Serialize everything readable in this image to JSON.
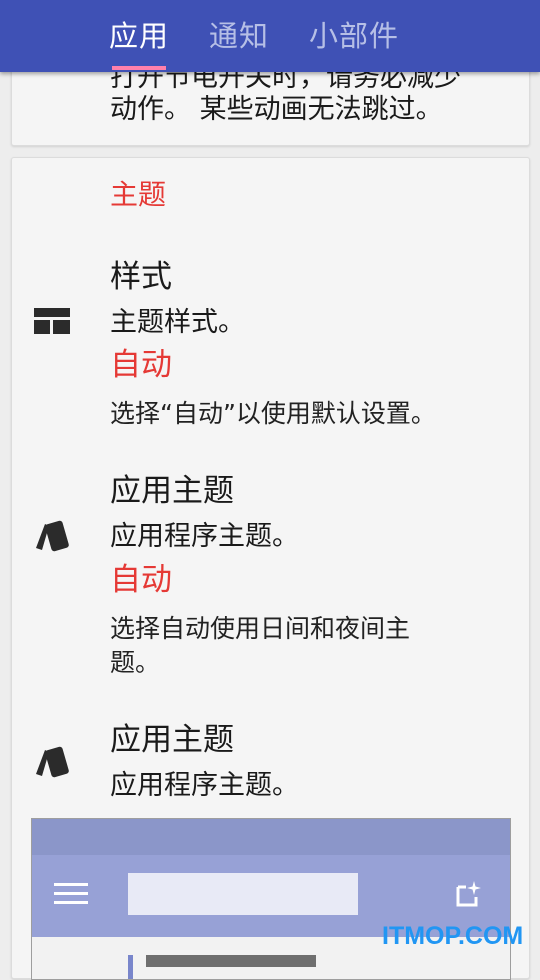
{
  "tabs": [
    {
      "label": "应用",
      "active": true
    },
    {
      "label": "通知",
      "active": false
    },
    {
      "label": "小部件",
      "active": false
    }
  ],
  "top_card": {
    "partial_line": "打开节电开关时，请务必减少",
    "line2": "动作。 某些动画无法跳过。"
  },
  "section_title": "主题",
  "settings": [
    {
      "icon": "layout-icon",
      "title": "样式",
      "subtitle": "主题样式。",
      "value": "自动",
      "description": "选择“自动”以使用默认设置。"
    },
    {
      "icon": "theme-cards-icon",
      "title": "应用主题",
      "subtitle": "应用程序主题。",
      "value": "自动",
      "description_line1": "选择自动使用日间和夜间主",
      "description_line2": "题。"
    },
    {
      "icon": "theme-cards-icon",
      "title": "应用主题",
      "subtitle": "应用程序主题。"
    }
  ],
  "preview": {
    "menu_icon": "hamburger-menu-icon",
    "action_icon": "add-widget-icon"
  },
  "watermark": "ITMOP.COM",
  "colors": {
    "accent": "#3f51b5",
    "highlight": "#e53935",
    "indicator": "#ff80ab"
  }
}
